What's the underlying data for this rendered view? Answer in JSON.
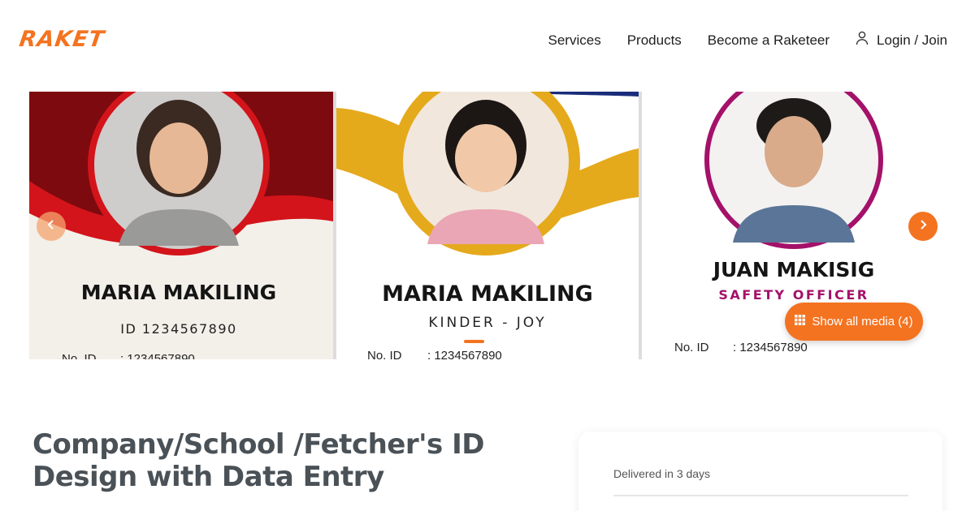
{
  "header": {
    "logo": "RAKET",
    "nav": {
      "services": "Services",
      "products": "Products",
      "become": "Become a Raketeer",
      "login": "Login / Join"
    }
  },
  "carousel": {
    "slides": [
      {
        "name": "MARIA MAKILING",
        "sub": "ID 1234567890",
        "id_label": "No. ID",
        "id_value": ": 1234567890",
        "accent": "#d3141b"
      },
      {
        "name": "MARIA MAKILING",
        "sub": "KINDER - JOY",
        "id_label": "No. ID",
        "id_value": ": 1234567890",
        "accent": "#e5a91c"
      },
      {
        "name": "JUAN MAKISIG",
        "sub": "SAFETY OFFICER",
        "id_label": "No. ID",
        "id_value": ": 1234567890",
        "accent": "#a4116a"
      }
    ],
    "show_media": "Show all media (4)",
    "active_dot": 1,
    "dot_count": 2
  },
  "product": {
    "title": "Company/School /Fetcher's ID Design with Data Entry"
  },
  "delivery": {
    "text": "Delivered in 3 days"
  },
  "colors": {
    "brand": "#f47320",
    "title": "#4a5157"
  }
}
